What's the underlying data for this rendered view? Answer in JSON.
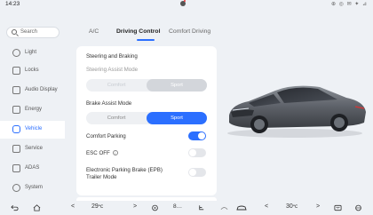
{
  "status": {
    "time": "14:23",
    "right": "⊕ ◎ ✉ ✦ ⊿"
  },
  "sidebar": {
    "search_placeholder": "Search",
    "items": [
      {
        "label": "Light",
        "icon": "light-icon"
      },
      {
        "label": "Locks",
        "icon": "lock-icon"
      },
      {
        "label": "Audio Display",
        "icon": "display-icon"
      },
      {
        "label": "Energy",
        "icon": "battery-icon"
      },
      {
        "label": "Vehicle",
        "icon": "car-icon",
        "active": true
      },
      {
        "label": "Service",
        "icon": "wrench-icon"
      },
      {
        "label": "ADAS",
        "icon": "adas-icon"
      },
      {
        "label": "System",
        "icon": "gear-icon"
      }
    ]
  },
  "tabs": [
    {
      "label": "A/C"
    },
    {
      "label": "Driving Control",
      "active": true
    },
    {
      "label": "Comfort Driving"
    }
  ],
  "panel": {
    "section_title": "Steering and Braking",
    "steering": {
      "title": "Steering Assist Mode",
      "options": [
        "Comfort",
        "Sport"
      ],
      "selected": "Sport",
      "enabled": false
    },
    "brake": {
      "title": "Brake Assist Mode",
      "options": [
        "Comfort",
        "Sport"
      ],
      "selected": "Sport",
      "enabled": true
    },
    "comfort_parking": {
      "label": "Comfort Parking",
      "on": true
    },
    "esc_off": {
      "label": "ESC OFF",
      "info": "i",
      "on": false
    },
    "epb": {
      "label_line1": "Electronic Parking Brake (EPB)",
      "label_line2": "Trailer Mode",
      "on": false
    }
  },
  "bottombar": {
    "left_temp": "29",
    "left_temp_unit": "℃",
    "right_temp": "30",
    "right_temp_unit": "℃",
    "fan_label": "8",
    "left_arrow": "<",
    "right_arrow": ">"
  },
  "colors": {
    "accent": "#2b6fff",
    "background": "#eef1f5",
    "panel": "#ffffff"
  }
}
